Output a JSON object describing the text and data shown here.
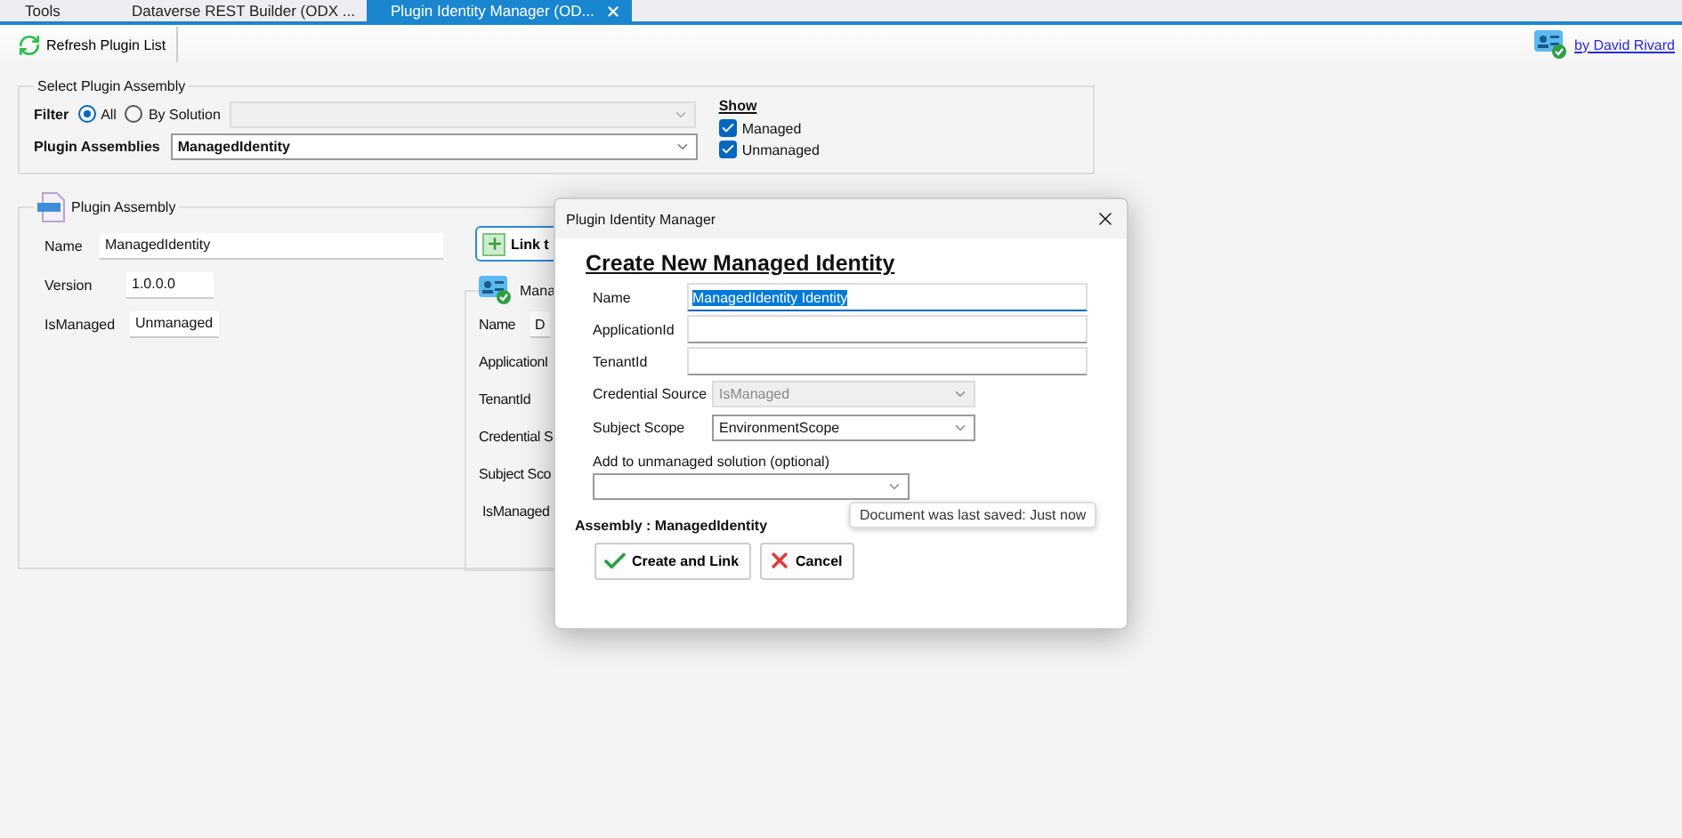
{
  "tabs": [
    {
      "label": "Tools",
      "selected": false,
      "closable": false
    },
    {
      "label": "Dataverse REST Builder (ODX ...",
      "selected": false,
      "closable": false
    },
    {
      "label": "Plugin Identity Manager (OD...",
      "selected": true,
      "closable": true
    }
  ],
  "toolbar": {
    "refresh_button": "Refresh Plugin List",
    "author_link": "by David Rivard"
  },
  "select_group": {
    "title": "Select Plugin Assembly",
    "filter_label": "Filter",
    "filter_options": [
      {
        "label": "All",
        "selected": true
      },
      {
        "label": "By Solution",
        "selected": false
      }
    ],
    "solution_select": {
      "disabled": true
    },
    "assemblies_label": "Plugin Assemblies",
    "assemblies_value": "ManagedIdentity",
    "show": {
      "title": "Show",
      "options": [
        {
          "label": "Managed",
          "checked": true
        },
        {
          "label": "Unmanaged",
          "checked": true
        }
      ]
    }
  },
  "assembly_group": {
    "title": "Plugin Assembly",
    "fields": [
      {
        "label": "Name",
        "value": "ManagedIdentity"
      },
      {
        "label": "Version",
        "value": "1.0.0.0"
      },
      {
        "label": "IsManaged",
        "value": "Unmanaged"
      }
    ]
  },
  "identity_panel": {
    "link_button": "Link t",
    "title": "Mana",
    "fields": [
      {
        "label": "Name",
        "value": "D"
      },
      {
        "label": "ApplicationI"
      },
      {
        "label": "TenantId"
      },
      {
        "label": "Credential S"
      },
      {
        "label": "Subject Sco"
      },
      {
        "label": "IsManaged"
      }
    ]
  },
  "dialog": {
    "title": "Plugin Identity Manager",
    "heading": "Create New Managed Identity",
    "fields": [
      {
        "kind": "text",
        "label": "Name",
        "value": "ManagedIdentity Identity",
        "selected_text": true
      },
      {
        "kind": "text",
        "label": "ApplicationId",
        "selected_text": false
      },
      {
        "kind": "text",
        "label": "TenantId",
        "selected_text": false
      },
      {
        "kind": "select",
        "label": "Credential Source",
        "value": "IsManaged",
        "disabled": true
      },
      {
        "kind": "select",
        "label": "Subject Scope",
        "value": "EnvironmentScope",
        "disabled": false
      }
    ],
    "solution_label": "Add to unmanaged solution (optional)",
    "assembly_label": "Assembly : ManagedIdentity",
    "buttons": [
      {
        "kind": "confirm",
        "label": "Create and Link"
      },
      {
        "kind": "cancel",
        "label": "Cancel"
      }
    ]
  },
  "tooltip": "Document was last saved: Just now"
}
